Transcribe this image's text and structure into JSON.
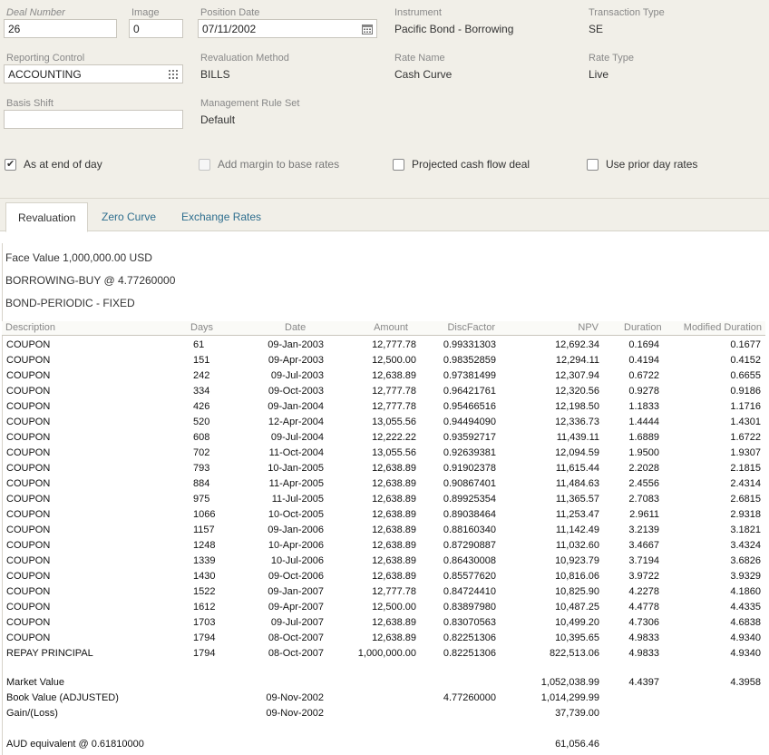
{
  "form": {
    "deal_number_label": "Deal Number",
    "deal_number_value": "26",
    "image_label": "Image",
    "image_value": "0",
    "position_date_label": "Position Date",
    "position_date_value": "07/11/2002",
    "instrument_label": "Instrument",
    "instrument_value": "Pacific Bond - Borrowing",
    "transaction_type_label": "Transaction Type",
    "transaction_type_value": "SE",
    "reporting_control_label": "Reporting Control",
    "reporting_control_value": "ACCOUNTING",
    "revaluation_method_label": "Revaluation Method",
    "revaluation_method_value": "BILLS",
    "rate_name_label": "Rate Name",
    "rate_name_value": "Cash Curve",
    "rate_type_label": "Rate Type",
    "rate_type_value": "Live",
    "basis_shift_label": "Basis Shift",
    "basis_shift_value": "",
    "management_rule_set_label": "Management Rule Set",
    "management_rule_set_value": "Default"
  },
  "checkboxes": {
    "as_at_end_of_day": {
      "label": "As at end of day",
      "checked": true
    },
    "add_margin": {
      "label": "Add margin to base rates",
      "checked": false
    },
    "projected_cash_flow": {
      "label": "Projected cash flow deal",
      "checked": false
    },
    "use_prior_day_rates": {
      "label": "Use prior day rates",
      "checked": false
    }
  },
  "tabs": [
    {
      "label": "Revaluation",
      "active": true
    },
    {
      "label": "Zero Curve",
      "active": false
    },
    {
      "label": "Exchange Rates",
      "active": false
    }
  ],
  "summary": {
    "face_value": "Face Value 1,000,000.00 USD",
    "borrowing": "BORROWING-BUY @ 4.77260000",
    "bond_type": "BOND-PERIODIC - FIXED"
  },
  "table": {
    "headers": [
      "Description",
      "Days",
      "Date",
      "Amount",
      "DiscFactor",
      "NPV",
      "Duration",
      "Modified Duration"
    ],
    "rows": [
      [
        "COUPON",
        "61",
        "09-Jan-2003",
        "12,777.78",
        "0.99331303",
        "12,692.34",
        "0.1694",
        "0.1677"
      ],
      [
        "COUPON",
        "151",
        "09-Apr-2003",
        "12,500.00",
        "0.98352859",
        "12,294.11",
        "0.4194",
        "0.4152"
      ],
      [
        "COUPON",
        "242",
        "09-Jul-2003",
        "12,638.89",
        "0.97381499",
        "12,307.94",
        "0.6722",
        "0.6655"
      ],
      [
        "COUPON",
        "334",
        "09-Oct-2003",
        "12,777.78",
        "0.96421761",
        "12,320.56",
        "0.9278",
        "0.9186"
      ],
      [
        "COUPON",
        "426",
        "09-Jan-2004",
        "12,777.78",
        "0.95466516",
        "12,198.50",
        "1.1833",
        "1.1716"
      ],
      [
        "COUPON",
        "520",
        "12-Apr-2004",
        "13,055.56",
        "0.94494090",
        "12,336.73",
        "1.4444",
        "1.4301"
      ],
      [
        "COUPON",
        "608",
        "09-Jul-2004",
        "12,222.22",
        "0.93592717",
        "11,439.11",
        "1.6889",
        "1.6722"
      ],
      [
        "COUPON",
        "702",
        "11-Oct-2004",
        "13,055.56",
        "0.92639381",
        "12,094.59",
        "1.9500",
        "1.9307"
      ],
      [
        "COUPON",
        "793",
        "10-Jan-2005",
        "12,638.89",
        "0.91902378",
        "11,615.44",
        "2.2028",
        "2.1815"
      ],
      [
        "COUPON",
        "884",
        "11-Apr-2005",
        "12,638.89",
        "0.90867401",
        "11,484.63",
        "2.4556",
        "2.4314"
      ],
      [
        "COUPON",
        "975",
        "11-Jul-2005",
        "12,638.89",
        "0.89925354",
        "11,365.57",
        "2.7083",
        "2.6815"
      ],
      [
        "COUPON",
        "1066",
        "10-Oct-2005",
        "12,638.89",
        "0.89038464",
        "11,253.47",
        "2.9611",
        "2.9318"
      ],
      [
        "COUPON",
        "1157",
        "09-Jan-2006",
        "12,638.89",
        "0.88160340",
        "11,142.49",
        "3.2139",
        "3.1821"
      ],
      [
        "COUPON",
        "1248",
        "10-Apr-2006",
        "12,638.89",
        "0.87290887",
        "11,032.60",
        "3.4667",
        "3.4324"
      ],
      [
        "COUPON",
        "1339",
        "10-Jul-2006",
        "12,638.89",
        "0.86430008",
        "10,923.79",
        "3.7194",
        "3.6826"
      ],
      [
        "COUPON",
        "1430",
        "09-Oct-2006",
        "12,638.89",
        "0.85577620",
        "10,816.06",
        "3.9722",
        "3.9329"
      ],
      [
        "COUPON",
        "1522",
        "09-Jan-2007",
        "12,777.78",
        "0.84724410",
        "10,825.90",
        "4.2278",
        "4.1860"
      ],
      [
        "COUPON",
        "1612",
        "09-Apr-2007",
        "12,500.00",
        "0.83897980",
        "10,487.25",
        "4.4778",
        "4.4335"
      ],
      [
        "COUPON",
        "1703",
        "09-Jul-2007",
        "12,638.89",
        "0.83070563",
        "10,499.20",
        "4.7306",
        "4.6838"
      ],
      [
        "COUPON",
        "1794",
        "08-Oct-2007",
        "12,638.89",
        "0.82251306",
        "10,395.65",
        "4.9833",
        "4.9340"
      ],
      [
        "REPAY PRINCIPAL",
        "1794",
        "08-Oct-2007",
        "1,000,000.00",
        "0.82251306",
        "822,513.06",
        "4.9833",
        "4.9340"
      ]
    ],
    "footer": {
      "market_value": {
        "label": "Market Value",
        "npv": "1,052,038.99",
        "duration": "4.4397",
        "modified_duration": "4.3958"
      },
      "book_value": {
        "label": "Book Value (ADJUSTED)",
        "date": "09-Nov-2002",
        "disc_factor": "4.77260000",
        "npv": "1,014,299.99"
      },
      "gain_loss": {
        "label": "Gain/(Loss)",
        "date": "09-Nov-2002",
        "npv": "37,739.00"
      },
      "aud_equivalent": {
        "label": "AUD equivalent @ 0.61810000",
        "npv": "61,056.46"
      }
    }
  }
}
